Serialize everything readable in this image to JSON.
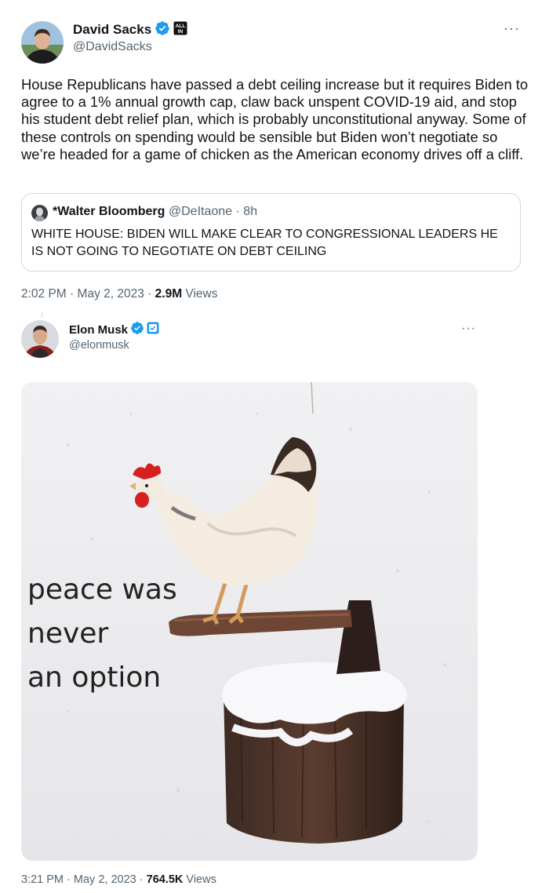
{
  "tweet1": {
    "author_name": "David Sacks",
    "author_handle": "@DavidSacks",
    "affiliate_badge": "ALL IN",
    "text": "House Republicans have passed a debt ceiling increase but it requires Biden to agree to a 1% annual growth cap, claw back unspent COVID-19 aid, and stop his student debt relief plan, which is probably unconstitutional anyway. Some of these controls on spending would be sensible but Biden won’t negotiate so we’re headed for a game of chicken as the American economy drives off a cliff.",
    "quote": {
      "author_name": "*Walter Bloomberg",
      "author_handle": "@DeItaone",
      "separator": "·",
      "age": "8h",
      "text": "WHITE HOUSE: BIDEN WILL MAKE CLEAR TO CONGRESSIONAL LEADERS HE IS NOT GOING TO NEGOTIATE ON DEBT CEILING"
    },
    "time": "2:02 PM",
    "date": "May 2, 2023",
    "views_count": "2.9M",
    "views_label": "Views",
    "dot": "·",
    "more": "···"
  },
  "tweet2": {
    "author_name": "Elon Musk",
    "author_handle": "@elonmusk",
    "meme_lines": [
      "peace was",
      "never",
      "an option"
    ],
    "time": "3:21 PM",
    "date": "May 2, 2023",
    "views_count": "764.5K",
    "views_label": "Views",
    "dot": "·",
    "more": "···"
  },
  "icons": {
    "verified": "verified-badge-icon",
    "affiliate": "all-in-badge-icon",
    "business": "x-affiliate-badge-icon",
    "more": "more-options-icon"
  },
  "colors": {
    "verified_blue": "#1d9bf0",
    "text": "#0f1419",
    "secondary": "#536471",
    "border": "#cfd9de"
  }
}
